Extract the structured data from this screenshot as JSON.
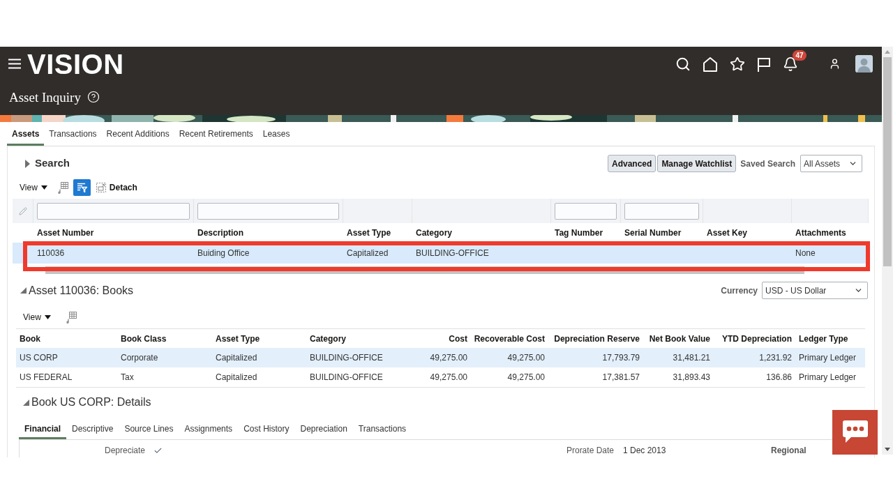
{
  "header": {
    "logo": "VISION",
    "notifications": "47",
    "title": "Asset Inquiry"
  },
  "tabs": [
    {
      "label": "Assets",
      "selected": true
    },
    {
      "label": "Transactions",
      "selected": false
    },
    {
      "label": "Recent Additions",
      "selected": false
    },
    {
      "label": "Recent Retirements",
      "selected": false
    },
    {
      "label": "Leases",
      "selected": false
    }
  ],
  "search": {
    "title": "Search",
    "expanded": false,
    "buttons": [
      "Advanced",
      "Manage Watchlist"
    ],
    "saved_search_label": "Saved Search",
    "saved_search": "All Assets"
  },
  "assets_toolbar": {
    "view": "View",
    "filter_active": true,
    "detach": "Detach"
  },
  "assets_table": {
    "columns": [
      {
        "label": "Asset Number",
        "filter": true
      },
      {
        "label": "Description",
        "filter": true
      },
      {
        "label": "Asset Type",
        "filter": false
      },
      {
        "label": "Category",
        "filter": false
      },
      {
        "label": "Tag Number",
        "filter": true
      },
      {
        "label": "Serial Number",
        "filter": true
      },
      {
        "label": "Asset Key",
        "filter": false
      },
      {
        "label": "Attachments",
        "filter": false
      }
    ],
    "rows": [
      {
        "cells": [
          "110036",
          "Buiding Office",
          "Capitalized",
          "BUILDING-OFFICE",
          null,
          null,
          null,
          "None"
        ],
        "selected": true,
        "highlighted": true
      }
    ]
  },
  "books": {
    "title": "Asset 110036: Books",
    "expanded": true,
    "currency_label": "Currency",
    "currency": "USD - US Dollar",
    "view": "View",
    "columns": [
      {
        "label": "Book",
        "kind": "text"
      },
      {
        "label": "Book Class",
        "kind": "text"
      },
      {
        "label": "Asset Type",
        "kind": "text"
      },
      {
        "label": "Category",
        "kind": "text"
      },
      {
        "label": "Cost",
        "kind": "amount"
      },
      {
        "label": "Recoverable Cost",
        "kind": "amount"
      },
      {
        "label": "Depreciation Reserve",
        "kind": "amount"
      },
      {
        "label": "Net Book Value",
        "kind": "amount"
      },
      {
        "label": "YTD Depreciation",
        "kind": "amount"
      },
      {
        "label": "Ledger Type",
        "kind": "text"
      }
    ],
    "rows": [
      {
        "cells": [
          "US CORP",
          "Corporate",
          "Capitalized",
          "BUILDING-OFFICE",
          "49,275.00",
          "49,275.00",
          "17,793.79",
          "31,481.21",
          "1,231.92",
          "Primary Ledger"
        ],
        "selected": true
      },
      {
        "cells": [
          "US FEDERAL",
          "Tax",
          "Capitalized",
          "BUILDING-OFFICE",
          "49,275.00",
          "49,275.00",
          "17,381.57",
          "31,893.43",
          "136.86",
          "Primary Ledger"
        ],
        "selected": false
      }
    ]
  },
  "details": {
    "title": "Book US CORP: Details",
    "expanded": true,
    "tabs": [
      {
        "label": "Financial",
        "selected": true
      },
      {
        "label": "Descriptive",
        "selected": false
      },
      {
        "label": "Source Lines",
        "selected": false
      },
      {
        "label": "Assignments",
        "selected": false
      },
      {
        "label": "Cost History",
        "selected": false
      },
      {
        "label": "Depreciation",
        "selected": false
      },
      {
        "label": "Transactions",
        "selected": false
      }
    ],
    "fields": [
      {
        "kind": "check",
        "label": "Depreciate",
        "checked": true
      },
      {
        "kind": "date",
        "label": "Prorate Date",
        "value": "1 Dec 2013"
      },
      {
        "kind": "heading",
        "label": "Regional"
      }
    ]
  }
}
